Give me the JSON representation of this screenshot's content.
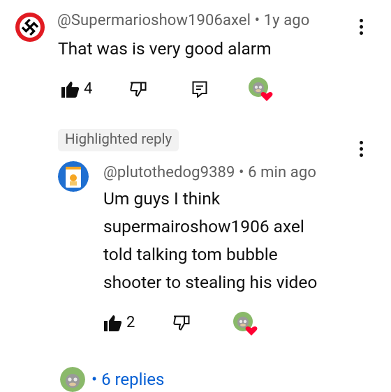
{
  "comment": {
    "handle": "@Supermarioshow1906axel",
    "time": "1y ago",
    "text": "That was is very good alarm",
    "likes": "4"
  },
  "highlight": {
    "label": "Highlighted reply"
  },
  "reply": {
    "handle": "@plutothedog9389",
    "time": "6 min ago",
    "text_lines": [
      "Um guys I think",
      "supermairoshow1906 axel",
      "told talking tom bubble",
      "shooter to stealing his video"
    ],
    "likes": "2"
  },
  "replies_link": {
    "label": "6 replies"
  },
  "separator": "•",
  "colors": {
    "link": "#065fd4",
    "meta": "#606060",
    "chip_bg": "#f2f2f2",
    "heart": "#ff0033"
  }
}
